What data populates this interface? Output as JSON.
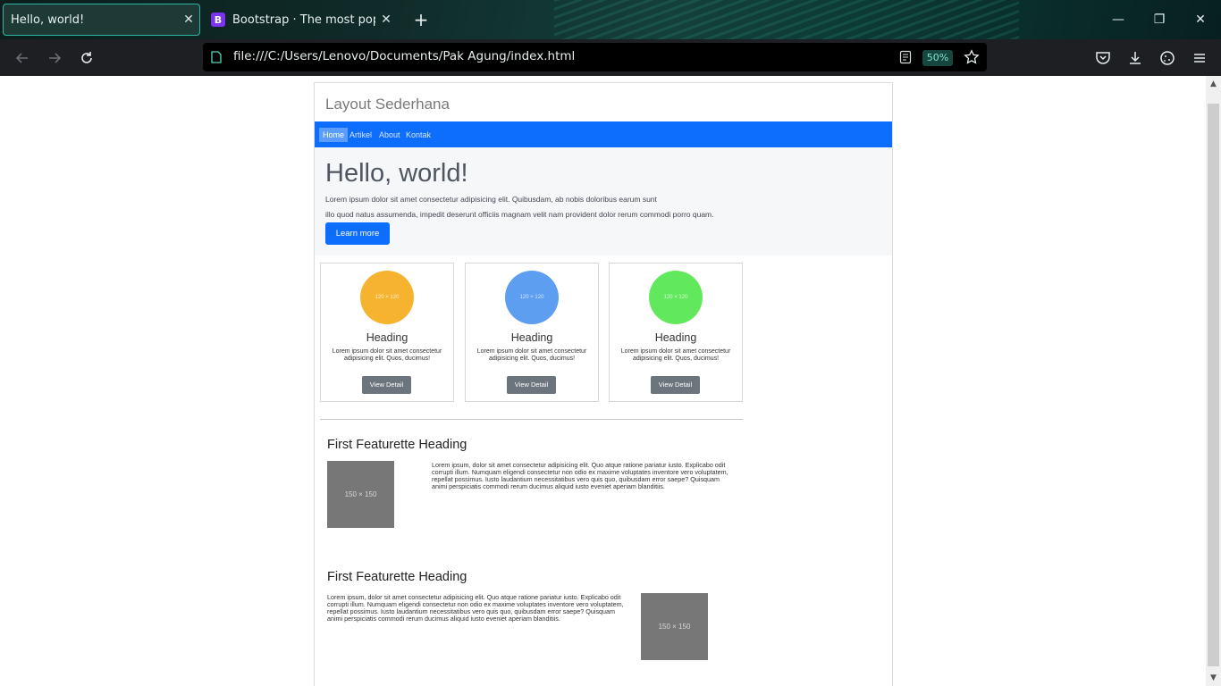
{
  "browser": {
    "tabs": [
      {
        "title": "Hello, world!",
        "active": true,
        "close": "✕"
      },
      {
        "title": "Bootstrap · The most popular HTML",
        "active": false,
        "favicon": "B",
        "close": "✕"
      }
    ],
    "new_tab": "+",
    "window_controls": {
      "minimize": "—",
      "restore": "❐",
      "close": "✕"
    },
    "url": "file:///C:/Users/Lenovo/Documents/Pak Agung/index.html",
    "zoom": "50%",
    "accent_color": "#2fb5a2"
  },
  "page": {
    "site_title": "Layout Sederhana",
    "nav": [
      "Home",
      "Artikel",
      "About",
      "Kontak"
    ],
    "nav_active": "Home",
    "jumbotron": {
      "title": "Hello, world!",
      "text_line1": "Lorem ipsum dolor sit amet consectetur adipisicing elit. Quibusdam, ab nobis doloribus earum sunt",
      "text_line2": "illo quod natus assumenda, impedit deserunt officiis magnam velit nam provident dolor rerum commodi porro quam.",
      "button": "Learn more"
    },
    "cards": [
      {
        "placeholder": "120 × 120",
        "color": "#f6b32f",
        "heading": "Heading",
        "text": "Lorem ipsum dolor sit amet consectetur adipisicing elit. Quos, ducimus!",
        "button": "View Detail"
      },
      {
        "placeholder": "120 × 120",
        "color": "#5d9ef0",
        "heading": "Heading",
        "text": "Lorem ipsum dolor sit amet consectetur adipisicing elit. Quos, ducimus!",
        "button": "View Detail"
      },
      {
        "placeholder": "120 × 120",
        "color": "#62e85c",
        "heading": "Heading",
        "text": "Lorem ipsum dolor sit amet consectetur adipisicing elit. Quos, ducimus!",
        "button": "View Detail"
      }
    ],
    "featurettes": [
      {
        "heading": "First Featurette Heading",
        "image": "150 × 150",
        "text": "Lorem ipsum, dolor sit amet consectetur adipisicing elit. Quo atque ratione pariatur iusto. Explicabo odit corrupti illum. Numquam eligendi consectetur non odio ex maxime voluptates inventore vero voluptatem, repellat possimus. Iusto laudantium necessitatibus vero quis quo, quibusdam error saepe? Quisquam animi perspiciatis commodi rerum ducimus aliquid iusto eveniet aperiam blanditiis."
      },
      {
        "heading": "First Featurette Heading",
        "image": "150 × 150",
        "text": "Lorem ipsum, dolor sit amet consectetur adipisicing elit. Quo atque ratione pariatur iusto. Explicabo odit corrupti illum. Numquam eligendi consectetur non odio ex maxime voluptates inventore vero voluptatem, repellat possimus. Iusto laudantium necessitatibus vero quis quo, quibusdam error saepe? Quisquam animi perspiciatis commodi rerum ducimus aliquid iusto eveniet aperiam blanditiis."
      }
    ]
  }
}
